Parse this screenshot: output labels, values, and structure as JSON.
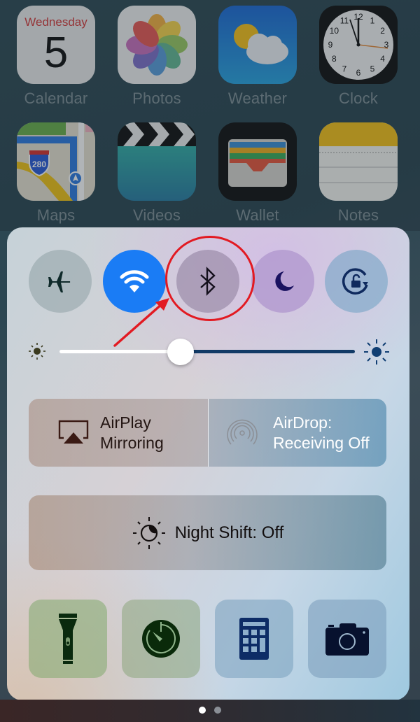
{
  "home_screen": {
    "apps": [
      {
        "name": "Calendar",
        "icon": "calendar-icon",
        "weekday": "Wednesday",
        "day": "5"
      },
      {
        "name": "Photos",
        "icon": "photos-icon"
      },
      {
        "name": "Weather",
        "icon": "weather-icon"
      },
      {
        "name": "Clock",
        "icon": "clock-icon",
        "numerals": [
          "12",
          "1",
          "2",
          "3",
          "4",
          "5",
          "6",
          "7",
          "8",
          "9",
          "10",
          "11"
        ]
      },
      {
        "name": "Maps",
        "icon": "maps-icon",
        "shield": "280"
      },
      {
        "name": "Videos",
        "icon": "videos-icon"
      },
      {
        "name": "Wallet",
        "icon": "wallet-icon"
      },
      {
        "name": "Notes",
        "icon": "notes-icon"
      }
    ]
  },
  "control_center": {
    "toggles": [
      {
        "id": "airplane-mode",
        "icon": "airplane-icon",
        "active": false
      },
      {
        "id": "wifi",
        "icon": "wifi-icon",
        "active": true,
        "color": "#1a7cf5"
      },
      {
        "id": "bluetooth",
        "icon": "bluetooth-icon",
        "active": false,
        "highlighted": true
      },
      {
        "id": "do-not-disturb",
        "icon": "moon-icon",
        "active": false
      },
      {
        "id": "rotation-lock",
        "icon": "rotation-lock-icon",
        "active": false
      }
    ],
    "brightness": {
      "value_percent": 41
    },
    "airplay": {
      "line1": "AirPlay",
      "line2": "Mirroring",
      "icon": "airplay-icon"
    },
    "airdrop": {
      "line1": "AirDrop:",
      "line2": "Receiving Off",
      "icon": "airdrop-icon"
    },
    "night_shift": {
      "label": "Night Shift: Off",
      "icon": "night-shift-icon"
    },
    "shortcuts": [
      {
        "id": "flashlight",
        "icon": "flashlight-icon"
      },
      {
        "id": "timer",
        "icon": "timer-icon"
      },
      {
        "id": "calculator",
        "icon": "calculator-icon"
      },
      {
        "id": "camera",
        "icon": "camera-icon"
      }
    ],
    "annotation": {
      "color": "#e21a22",
      "target": "bluetooth"
    }
  },
  "page_indicator": {
    "count": 2,
    "current": 1
  }
}
